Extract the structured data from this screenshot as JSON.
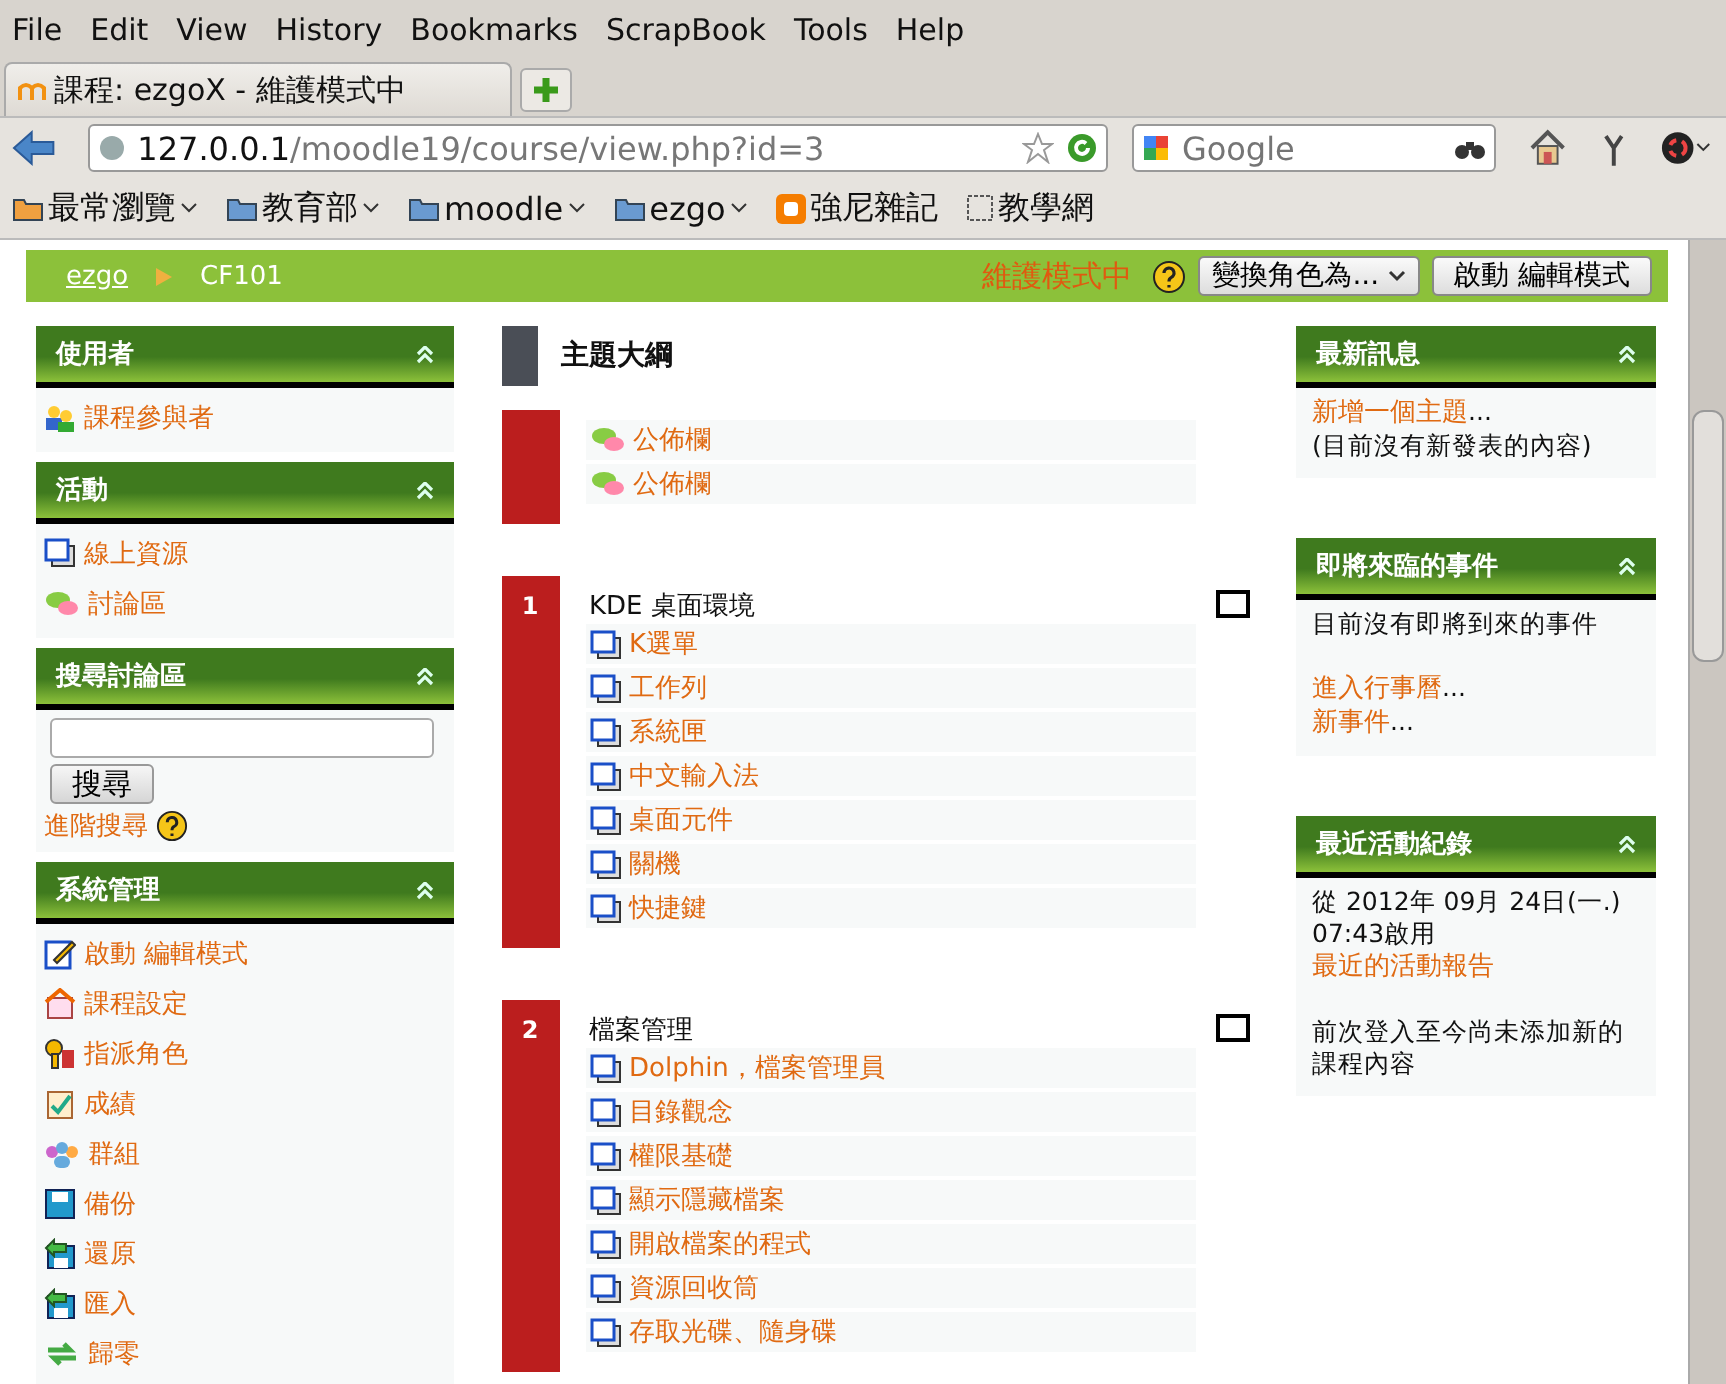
{
  "menu": [
    "File",
    "Edit",
    "View",
    "History",
    "Bookmarks",
    "ScrapBook",
    "Tools",
    "Help"
  ],
  "tab": {
    "title": "課程: ezgoX - 維護模式中",
    "selected": true
  },
  "url": {
    "host": "127.0.0.1",
    "path": "/moodle19/course/view.php?id=3"
  },
  "search": {
    "placeholder": "Google"
  },
  "bookmarks": [
    {
      "label": "最常瀏覽",
      "kind": "smart"
    },
    {
      "label": "教育部",
      "kind": "folder"
    },
    {
      "label": "moodle",
      "kind": "folder"
    },
    {
      "label": "ezgo",
      "kind": "folder"
    },
    {
      "label": "強尼雜記",
      "kind": "blog"
    },
    {
      "label": "教學網",
      "kind": "page"
    }
  ],
  "breadcrumb": [
    "ezgo",
    "CF101"
  ],
  "header": {
    "mode": "維護模式中",
    "role_select": "變換角色為...",
    "edit_button": "啟動 編輯模式"
  },
  "left_blocks": [
    {
      "title": "使用者",
      "kind": "links",
      "items": [
        {
          "label": "課程參與者",
          "kind": "participants"
        }
      ]
    },
    {
      "title": "活動",
      "kind": "links",
      "items": [
        {
          "label": "線上資源",
          "kind": "resource"
        },
        {
          "label": "討論區",
          "kind": "forum"
        }
      ]
    },
    {
      "title": "搜尋討論區",
      "kind": "search",
      "button": "搜尋",
      "link": "進階搜尋"
    },
    {
      "title": "系統管理",
      "kind": "links",
      "items": [
        {
          "label": "啟動 編輯模式",
          "kind": "edit"
        },
        {
          "label": "課程設定",
          "kind": "settings"
        },
        {
          "label": "指派角色",
          "kind": "roles"
        },
        {
          "label": "成績",
          "kind": "grades"
        },
        {
          "label": "群組",
          "kind": "groups"
        },
        {
          "label": "備份",
          "kind": "backup"
        },
        {
          "label": "還原",
          "kind": "restore"
        },
        {
          "label": "匯入",
          "kind": "restore"
        },
        {
          "label": "歸零",
          "kind": "reset"
        }
      ]
    }
  ],
  "outline": {
    "title": "主題大綱",
    "sections": [
      {
        "items": [
          {
            "label": "公佈欄",
            "kind": "forum"
          },
          {
            "label": "公佈欄",
            "kind": "forum"
          }
        ]
      },
      {
        "number": "1",
        "title": "KDE 桌面環境",
        "items": [
          {
            "label": "K選單",
            "kind": "resource"
          },
          {
            "label": "工作列",
            "kind": "resource"
          },
          {
            "label": "系統匣",
            "kind": "resource"
          },
          {
            "label": "中文輸入法",
            "kind": "resource"
          },
          {
            "label": "桌面元件",
            "kind": "resource"
          },
          {
            "label": "關機",
            "kind": "resource"
          },
          {
            "label": "快捷鍵",
            "kind": "resource"
          }
        ]
      },
      {
        "number": "2",
        "title": "檔案管理",
        "items": [
          {
            "label": "Dolphin，檔案管理員",
            "kind": "resource"
          },
          {
            "label": "目錄觀念",
            "kind": "resource"
          },
          {
            "label": "權限基礎",
            "kind": "resource"
          },
          {
            "label": "顯示隱藏檔案",
            "kind": "resource"
          },
          {
            "label": "開啟檔案的程式",
            "kind": "resource"
          },
          {
            "label": "資源回收筒",
            "kind": "resource"
          },
          {
            "label": "存取光碟、隨身碟",
            "kind": "resource"
          }
        ]
      }
    ]
  },
  "right_blocks": [
    {
      "title": "最新訊息",
      "groups": [
        [
          {
            "kind": "link",
            "label": "新增一個主題",
            "suffix": "..."
          },
          {
            "kind": "text",
            "text": "(目前沒有新發表的內容)"
          }
        ]
      ]
    },
    {
      "title": "即將來臨的事件",
      "groups": [
        [
          {
            "kind": "text",
            "text": "目前沒有即將到來的事件"
          }
        ],
        [
          {
            "kind": "link",
            "label": "進入行事曆",
            "suffix": "..."
          },
          {
            "kind": "link",
            "label": "新事件",
            "suffix": "..."
          }
        ]
      ]
    },
    {
      "title": "最近活動紀錄",
      "groups": [
        [
          {
            "kind": "text",
            "text": "從 2012年 09月 24日(一.) 07:43啟用"
          },
          {
            "kind": "link",
            "label": "最近的活動報告"
          }
        ],
        [
          {
            "kind": "text",
            "text": "前次登入至今尚未添加新的課程內容"
          }
        ]
      ]
    }
  ]
}
